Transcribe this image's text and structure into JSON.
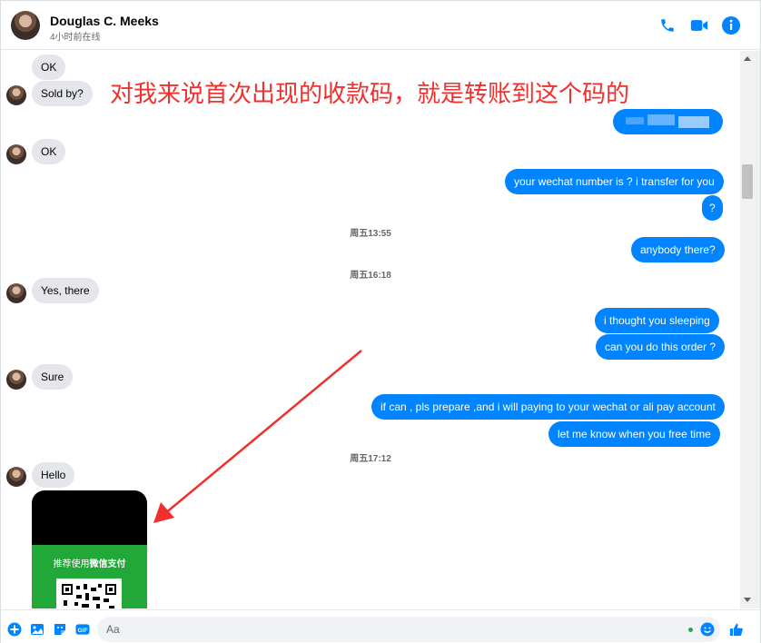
{
  "header": {
    "name": "Douglas C. Meeks",
    "status": "4小时前在线"
  },
  "annotation": "对我来说首次出现的收款码，就是转账到这个码的",
  "messages": {
    "m1": "OK",
    "m2": "Sold by?",
    "m3": "OK",
    "m4": "your wechat number is ? i transfer for you",
    "m5": "?",
    "m6": "anybody there?",
    "m7": "Yes, there",
    "m8": "i thought  you sleeping",
    "m9": "can you do this order ?",
    "m10": "Sure",
    "m11": "if can , pls prepare ,and i will paying to your wechat or ali pay account",
    "m12": "let me know  when you free time",
    "m13": "Hello"
  },
  "timestamps": {
    "t1": "周五13:55",
    "t2": "周五16:18",
    "t3": "周五17:12"
  },
  "qr": {
    "label_prefix": "推荐使用",
    "label_bold": "微信支付"
  },
  "composer": {
    "placeholder": "Aa"
  },
  "colors": {
    "accent": "#0084ff",
    "incoming": "#e4e6eb",
    "annotation": "#f0302c",
    "wechat_green": "#21a838"
  }
}
